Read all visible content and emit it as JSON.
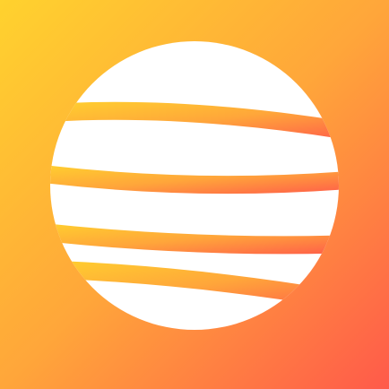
{
  "icon": {
    "name": "striped-sphere-logo",
    "shape": "circle with curved horizontal bands",
    "band_count": 4
  },
  "colors": {
    "gradient_start": "#FFD22E",
    "gradient_mid": "#FFA63A",
    "gradient_end": "#FF5A4A",
    "glyph": "#FFFFFF"
  }
}
